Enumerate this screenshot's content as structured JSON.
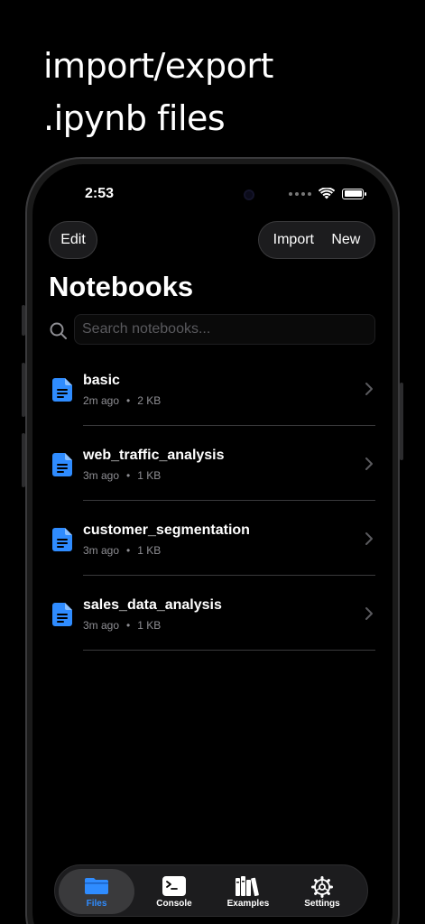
{
  "headline": {
    "line1": "import/export",
    "line2": ".ipynb files"
  },
  "status_bar": {
    "time": "2:53"
  },
  "nav": {
    "edit_label": "Edit",
    "import_label": "Import",
    "new_label": "New"
  },
  "page": {
    "title": "Notebooks"
  },
  "search": {
    "placeholder": "Search notebooks...",
    "value": ""
  },
  "notebooks": [
    {
      "name": "basic",
      "modified": "2m ago",
      "size": "2 KB"
    },
    {
      "name": "web_traffic_analysis",
      "modified": "3m ago",
      "size": "1 KB"
    },
    {
      "name": "customer_segmentation",
      "modified": "3m ago",
      "size": "1 KB"
    },
    {
      "name": "sales_data_analysis",
      "modified": "3m ago",
      "size": "1 KB"
    }
  ],
  "meta_separator": "•",
  "tabs": [
    {
      "label": "Files",
      "icon": "folder-icon",
      "active": true
    },
    {
      "label": "Console",
      "icon": "terminal-icon",
      "active": false
    },
    {
      "label": "Examples",
      "icon": "books-icon",
      "active": false
    },
    {
      "label": "Settings",
      "icon": "gear-icon",
      "active": false
    }
  ],
  "colors": {
    "accent": "#2f8cff",
    "background": "#000000",
    "secondary_text": "#8e8e93"
  }
}
